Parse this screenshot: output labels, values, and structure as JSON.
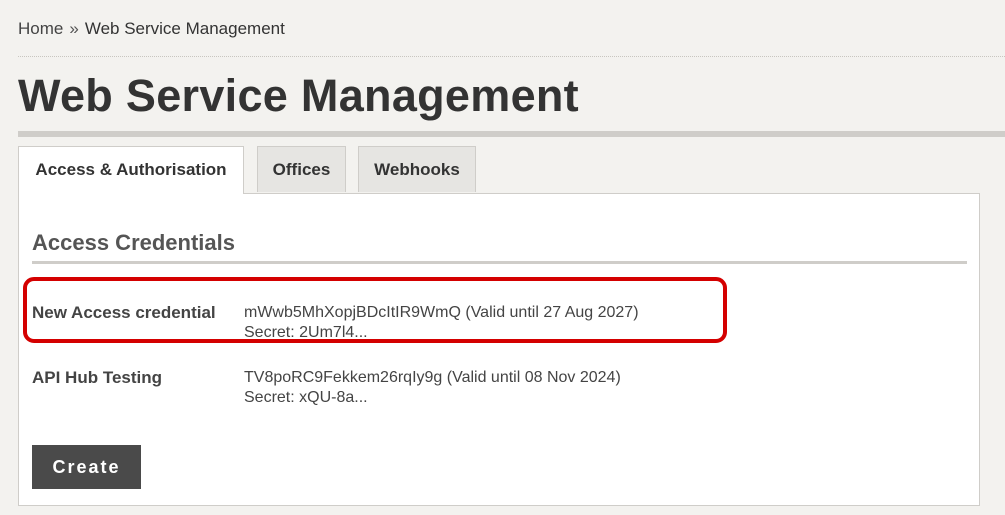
{
  "breadcrumb": {
    "home": "Home",
    "separator": "»",
    "current": "Web Service Management"
  },
  "page": {
    "title": "Web Service Management"
  },
  "tabs": [
    {
      "label": "Access & Authorisation",
      "active": true
    },
    {
      "label": "Offices",
      "active": false
    },
    {
      "label": "Webhooks",
      "active": false
    }
  ],
  "section": {
    "title": "Access Credentials"
  },
  "credentials": [
    {
      "name": "New Access credential",
      "key_line": "mWwb5MhXopjBDcItIR9WmQ (Valid until 27 Aug 2027)",
      "secret_line": "Secret: 2Um7l4...",
      "highlighted": true
    },
    {
      "name": "API Hub Testing",
      "key_line": "TV8poRC9Fekkem26rqIy9g (Valid until 08 Nov 2024)",
      "secret_line": "Secret: xQU-8a...",
      "highlighted": false
    }
  ],
  "actions": {
    "create_label": "Create"
  },
  "colors": {
    "background": "#f3f2ef",
    "highlight": "#d40000",
    "button": "#4a4a4a"
  }
}
